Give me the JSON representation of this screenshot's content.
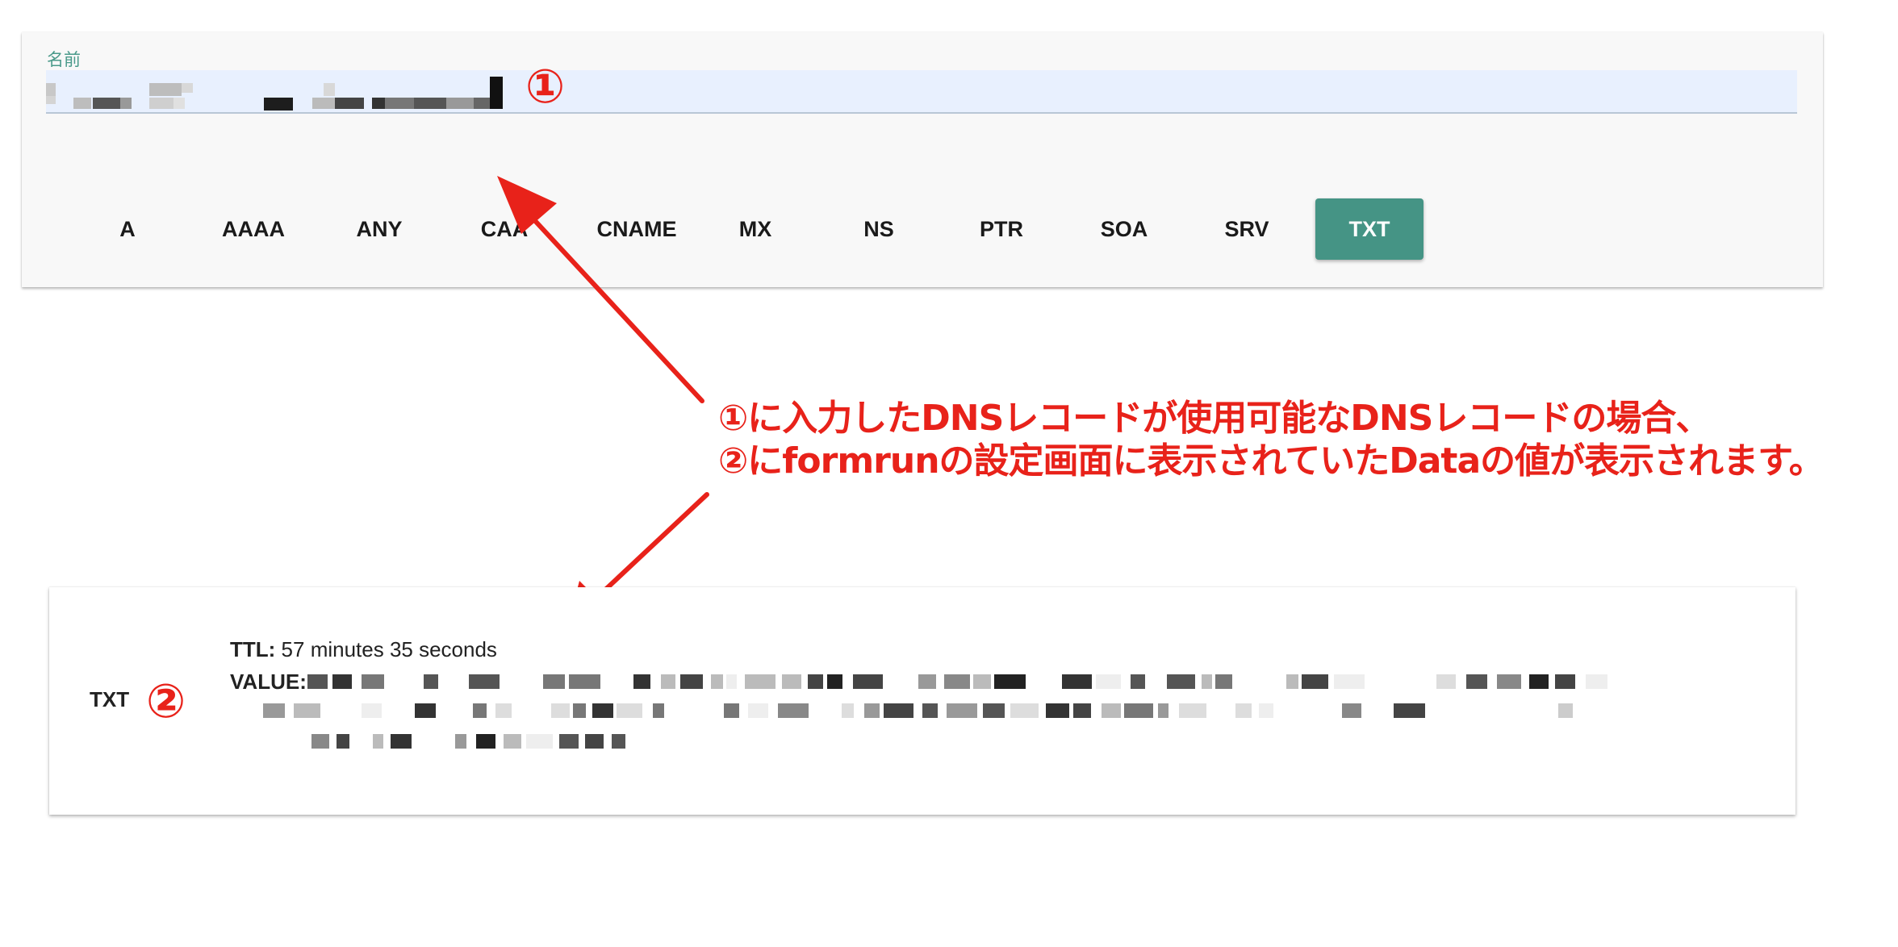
{
  "search": {
    "name_label": "名前",
    "name_value": "",
    "marker": "①"
  },
  "record_types": {
    "items": [
      "A",
      "AAAA",
      "ANY",
      "CAA",
      "CNAME",
      "MX",
      "NS",
      "PTR",
      "SOA",
      "SRV",
      "TXT"
    ],
    "selected": "TXT"
  },
  "annotation": {
    "line1": "①に入力したDNSレコードが使用可能なDNSレコードの場合、",
    "line2": "②にformrunの設定画面に表示されていたDataの値が表示されます。"
  },
  "result": {
    "record_type": "TXT",
    "marker": "②",
    "ttl_label": "TTL:",
    "ttl_value": "57 minutes 35 seconds",
    "value_label": "VALUE:",
    "value": ""
  },
  "colors": {
    "accent": "#459485",
    "label_teal": "#4a9a8a",
    "annotation_red": "#e8221a",
    "field_bg": "#e8f0fe"
  }
}
